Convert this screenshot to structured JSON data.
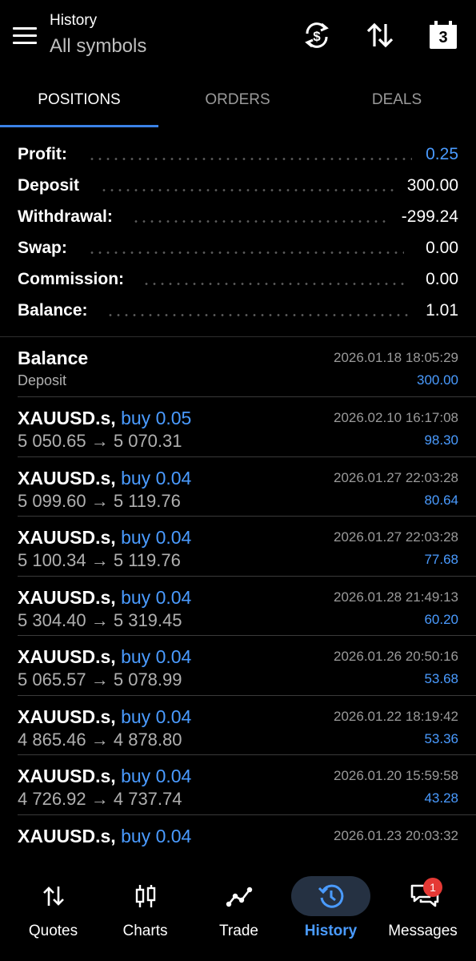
{
  "header": {
    "title": "History",
    "subtitle": "All symbols",
    "calendar_day": "3",
    "icons": [
      "menu-icon",
      "currency-exchange-icon",
      "sort-icon",
      "calendar-icon"
    ]
  },
  "tabs": [
    {
      "label": "POSITIONS",
      "active": true
    },
    {
      "label": "ORDERS",
      "active": false
    },
    {
      "label": "DEALS",
      "active": false
    }
  ],
  "summary": {
    "profit": {
      "label": "Profit:",
      "value": "0.25"
    },
    "deposit": {
      "label": "Deposit",
      "value": "300.00"
    },
    "withdrawal": {
      "label": "Withdrawal:",
      "value": "-299.24"
    },
    "swap": {
      "label": "Swap:",
      "value": "0.00"
    },
    "commission": {
      "label": "Commission:",
      "value": "0.00"
    },
    "balance": {
      "label": "Balance:",
      "value": "1.01"
    }
  },
  "list": {
    "balance_entry": {
      "title": "Balance",
      "subtitle": "Deposit",
      "date": "2026.01.18 18:05:29",
      "amount": "300.00"
    },
    "positions": [
      {
        "symbol": "XAUUSD.s,",
        "action": "buy 0.05",
        "prices": "5 050.65 → 5 070.31",
        "date": "2026.02.10 16:17:08",
        "profit": "98.30"
      },
      {
        "symbol": "XAUUSD.s,",
        "action": "buy 0.04",
        "prices": "5 099.60 → 5 119.76",
        "date": "2026.01.27 22:03:28",
        "profit": "80.64"
      },
      {
        "symbol": "XAUUSD.s,",
        "action": "buy 0.04",
        "prices": "5 100.34 → 5 119.76",
        "date": "2026.01.27 22:03:28",
        "profit": "77.68"
      },
      {
        "symbol": "XAUUSD.s,",
        "action": "buy 0.04",
        "prices": "5 304.40 → 5 319.45",
        "date": "2026.01.28 21:49:13",
        "profit": "60.20"
      },
      {
        "symbol": "XAUUSD.s,",
        "action": "buy 0.04",
        "prices": "5 065.57 → 5 078.99",
        "date": "2026.01.26 20:50:16",
        "profit": "53.68"
      },
      {
        "symbol": "XAUUSD.s,",
        "action": "buy 0.04",
        "prices": "4 865.46 → 4 878.80",
        "date": "2026.01.22 18:19:42",
        "profit": "53.36"
      },
      {
        "symbol": "XAUUSD.s,",
        "action": "buy 0.04",
        "prices": "4 726.92 → 4 737.74",
        "date": "2026.01.20 15:59:58",
        "profit": "43.28"
      },
      {
        "symbol": "XAUUSD.s,",
        "action": "buy 0.04",
        "prices": "",
        "date": "2026.01.23 20:03:32",
        "profit": ""
      }
    ]
  },
  "nav": {
    "items": [
      {
        "label": "Quotes",
        "icon": "quotes-icon"
      },
      {
        "label": "Charts",
        "icon": "candlestick-icon"
      },
      {
        "label": "Trade",
        "icon": "trade-icon"
      },
      {
        "label": "History",
        "icon": "history-icon",
        "active": true
      },
      {
        "label": "Messages",
        "icon": "messages-icon"
      }
    ],
    "messages_badge": "1"
  },
  "colors": {
    "accent": "#4a9bff",
    "active_pill": "#253142",
    "badge": "#e53935"
  }
}
